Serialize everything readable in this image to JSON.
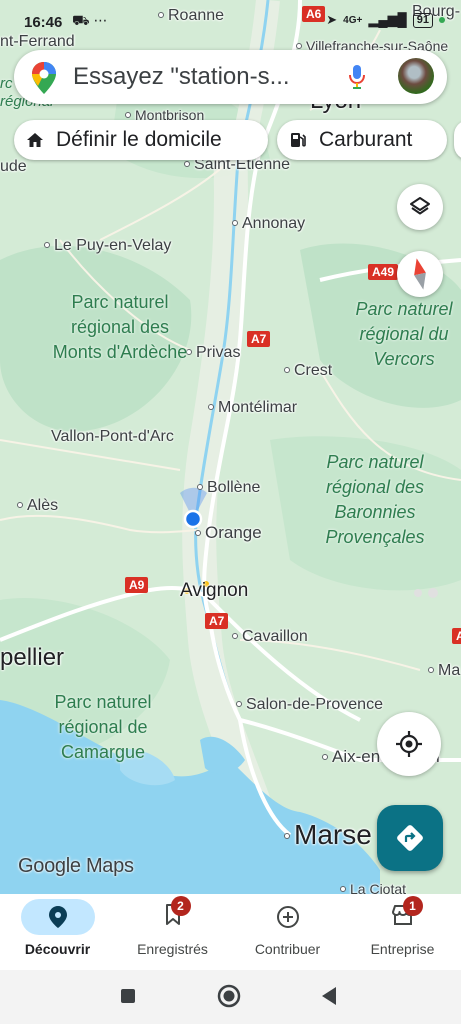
{
  "status_bar": {
    "time": "16:46",
    "left_icons": "⛟ ⋯",
    "signal": "4G+",
    "battery": "91"
  },
  "search": {
    "placeholder": "Essayez \"station-s..."
  },
  "chips": [
    {
      "label": "Définir le domicile",
      "icon": "home-icon"
    },
    {
      "label": "Carburant",
      "icon": "fuel-pump-icon"
    }
  ],
  "map": {
    "cities": [
      {
        "name": "Roanne"
      },
      {
        "name": "nt-Ferrand"
      },
      {
        "name": "Villefranche-sur-Saône"
      },
      {
        "name": "Bourg-"
      },
      {
        "name": "Lyon"
      },
      {
        "name": "Montbrison"
      },
      {
        "name": "Saint-Étienne"
      },
      {
        "name": "ude"
      },
      {
        "name": "Annonay"
      },
      {
        "name": "Le Puy-en-Velay"
      },
      {
        "name": "Privas"
      },
      {
        "name": "Crest"
      },
      {
        "name": "Montélimar"
      },
      {
        "name": "Vallon-Pont-d'Arc"
      },
      {
        "name": "Bollène"
      },
      {
        "name": "Alès"
      },
      {
        "name": "Orange"
      },
      {
        "name": "Avignon"
      },
      {
        "name": "Cavaillon"
      },
      {
        "name": "pellier"
      },
      {
        "name": "Ma"
      },
      {
        "name": "Salon-de-Provence"
      },
      {
        "name": "Aix-en-Proven"
      },
      {
        "name": "Marse"
      },
      {
        "name": "La Ciotat"
      }
    ],
    "parks": [
      {
        "name": "Parc naturel régional des Monts d'Ardèche"
      },
      {
        "name": "Parc naturel régional du Vercors"
      },
      {
        "name": "Parc naturel régional des Baronnies Provençales"
      },
      {
        "name": "Parc naturel régional de Camargue"
      },
      {
        "name": "rc naturel régional"
      }
    ],
    "roads": [
      "A6",
      "A7",
      "A49",
      "A7",
      "A9",
      "A7",
      "A"
    ],
    "logo": "Google Maps"
  },
  "bottom_nav": [
    {
      "label": "Découvrir",
      "icon": "explore-pin-icon",
      "active": true,
      "badge": ""
    },
    {
      "label": "Enregistrés",
      "icon": "bookmark-icon",
      "active": false,
      "badge": "2"
    },
    {
      "label": "Contribuer",
      "icon": "add-circle-icon",
      "active": false,
      "badge": ""
    },
    {
      "label": "Entreprise",
      "icon": "store-icon",
      "active": false,
      "badge": "1"
    }
  ],
  "colors": {
    "land": "#cde8d1",
    "forest": "#b8dfc2",
    "water": "#8fd3f0",
    "road": "#ffffff",
    "highway_shield": "#d93025",
    "accent": "#0b7285",
    "location_dot": "#1a73e8",
    "active_tab_bg": "#c2e7ff"
  }
}
